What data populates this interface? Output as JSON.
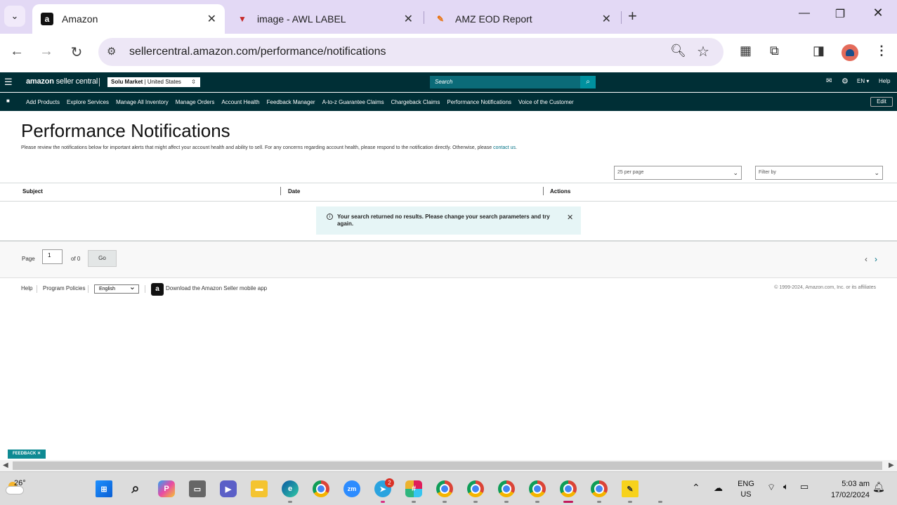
{
  "browser": {
    "tabs": [
      {
        "title": "Amazon",
        "favicon": "a"
      },
      {
        "title": "image - AWL LABEL",
        "favicon": "▼"
      },
      {
        "title": "AMZ EOD Report",
        "favicon": "✎"
      }
    ],
    "url": "sellercentral.amazon.com/performance/notifications"
  },
  "header": {
    "logo_bold": "amazon",
    "logo_rest": " seller central",
    "market_name": "Solu Market",
    "market_region": "United States",
    "search_placeholder": "Search",
    "language": "EN",
    "help": "Help"
  },
  "nav": {
    "links": [
      "Add Products",
      "Explore Services",
      "Manage All Inventory",
      "Manage Orders",
      "Account Health",
      "Feedback Manager",
      "A-to-z Guarantee Claims",
      "Chargeback Claims",
      "Performance Notifications",
      "Voice of the Customer"
    ],
    "edit": "Edit"
  },
  "page": {
    "title": "Performance Notifications",
    "description": "Please review the notifications below for important alerts that might affect your account health and ability to sell. For any concerns regarding account health, please respond to the notification directly. Otherwise, please ",
    "contact_link": "contact us",
    "description_end": ".",
    "per_page": "25 per page",
    "filter_placeholder": "Filter by",
    "columns": [
      "Subject",
      "Date",
      "Actions"
    ],
    "alert_message": "Your search returned no results. Please change your search parameters and try again.",
    "pager": {
      "page_label": "Page",
      "page_value": "1",
      "of_label": "of 0",
      "go": "Go"
    }
  },
  "footer": {
    "help": "Help",
    "program_policies": "Program Policies",
    "language": "English",
    "app_text": "Download the Amazon Seller mobile app",
    "copyright": "© 1999-2024, Amazon.com, Inc. or its affiliates"
  },
  "feedback": "FEEDBACK",
  "taskbar": {
    "temperature": "26°",
    "telegram_badge": "2",
    "lang_line1": "ENG",
    "lang_line2": "US",
    "time": "5:03 am",
    "date": "17/02/2024"
  }
}
